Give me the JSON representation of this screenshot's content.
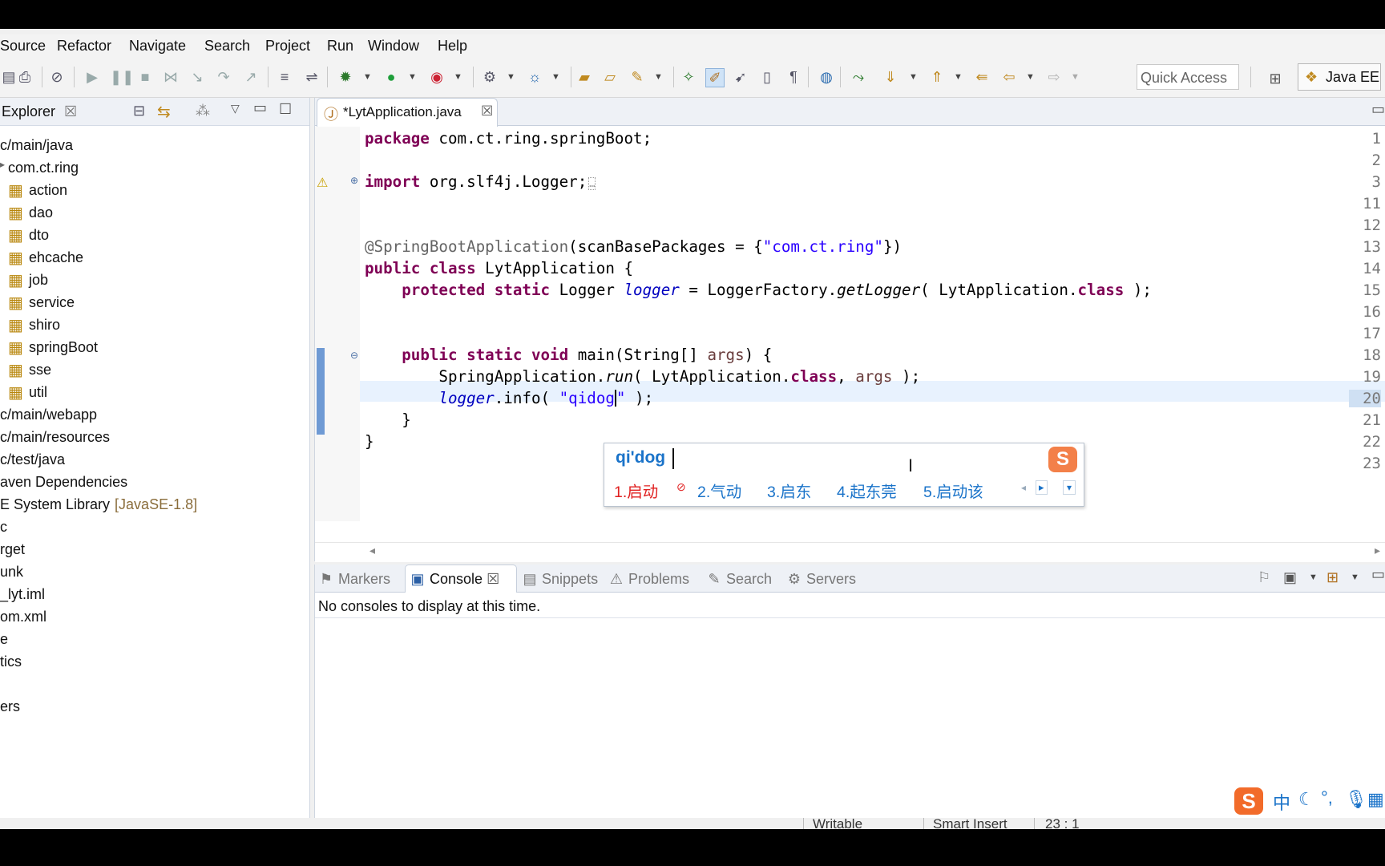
{
  "menu": [
    "Source",
    "Refactor",
    "Navigate",
    "Search",
    "Project",
    "Run",
    "Window",
    "Help"
  ],
  "toolbar": {
    "quick_access": "Quick Access",
    "perspective": "Java EE"
  },
  "explorer": {
    "title": "Explorer",
    "items": [
      "c/main/java",
      "com.ct.ring",
      "action",
      "dao",
      "dto",
      "ehcache",
      "job",
      "service",
      "shiro",
      "springBoot",
      "sse",
      "util",
      "c/main/webapp",
      "c/main/resources",
      "c/test/java",
      "aven Dependencies",
      "E System Library",
      "c",
      "rget",
      "unk",
      "_lyt.iml",
      "om.xml",
      "e",
      "tics",
      "ers"
    ],
    "jre_suffix": "[JavaSE-1.8]"
  },
  "editor": {
    "tab_title": "*LytApplication.java",
    "line_numbers": [
      "1",
      "2",
      "3",
      "11",
      "12",
      "13",
      "14",
      "15",
      "16",
      "17",
      "18",
      "19",
      "20",
      "21",
      "22",
      "23"
    ],
    "code": {
      "l1_kw": "package",
      "l1_rest": " com.ct.ring.springBoot;",
      "l3_kw": "import",
      "l3_rest": " org.slf4j.Logger;",
      "l13_ann": "@SpringBootApplication",
      "l13_a": "(scanBasePackages = {",
      "l13_str": "\"com.ct.ring\"",
      "l13_b": "})",
      "l14_kw": "public class",
      "l14_rest": " LytApplication {",
      "l15_kw": "protected static",
      "l15_a": " Logger ",
      "l15_fld": "logger",
      "l15_b": " = LoggerFactory.",
      "l15_m": "getLogger",
      "l15_c": "( LytApplication.",
      "l15_kw2": "class",
      "l15_d": " );",
      "l18_kw": "public static void",
      "l18_a": " main(String[] ",
      "l18_var": "args",
      "l18_b": ") {",
      "l19_a": "SpringApplication.",
      "l19_m": "run",
      "l19_b": "( LytApplication.",
      "l19_kw": "class",
      "l19_c": ", ",
      "l19_var": "args",
      "l19_d": " );",
      "l20_fld": "logger",
      "l20_a": ".info( ",
      "l20_str": "\"qidog",
      "l20_str2": "\"",
      "l20_b": " );",
      "l21": "}",
      "l22": "}"
    }
  },
  "ime": {
    "composition": "qi'dog",
    "candidates": [
      "1.启动",
      "2.气动",
      "3.启东",
      "4.起东莞",
      "5.启动该"
    ]
  },
  "console": {
    "tabs": [
      "Markers",
      "Console",
      "Snippets",
      "Problems",
      "Search",
      "Servers"
    ],
    "message": "No consoles to display at this time."
  },
  "status": {
    "writable": "Writable",
    "insert_mode": "Smart Insert",
    "position": "23 : 1"
  },
  "ime_bar": {
    "mode": "中"
  },
  "colors": {
    "keyword": "#7f0055",
    "string": "#2a00ff",
    "field": "#0000c0",
    "annotation": "#646464",
    "ime_blue": "#1a73c9",
    "ime_red": "#e02020",
    "sogou_orange": "#f26b2a"
  }
}
